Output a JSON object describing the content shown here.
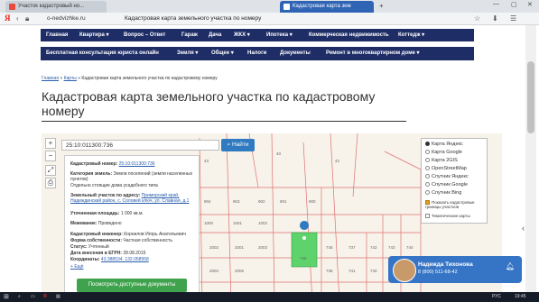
{
  "browser": {
    "tabs": [
      {
        "label": "Участок кадастровый но..."
      },
      {
        "label": "Кадастровая карта зем"
      }
    ],
    "url": "o-nedvizhke.ru",
    "page_title": "Кадастровая карта земельного участка по номеру",
    "yandex_logo": "Я"
  },
  "nav_primary": [
    {
      "label": "Главная"
    },
    {
      "label": "Квартира ▾"
    },
    {
      "label": "Вопрос – Ответ"
    },
    {
      "label": "Гараж"
    },
    {
      "label": "Дача"
    },
    {
      "label": "ЖКХ ▾"
    },
    {
      "label": "Ипотека ▾"
    },
    {
      "label": "Коммерческая недвижимость"
    },
    {
      "label": "Коттедж ▾"
    }
  ],
  "nav_secondary": [
    {
      "label": "Бесплатная консультация юриста онлайн"
    },
    {
      "label": "Земля ▾"
    },
    {
      "label": "Общее ▾"
    },
    {
      "label": "Налоги"
    },
    {
      "label": "Документы"
    },
    {
      "label": "Ремонт в многоквартирном доме ▾"
    }
  ],
  "breadcrumb": {
    "home": "Главная",
    "sep1": "»",
    "maps": "Карты",
    "sep2": "»",
    "current": "Кадастровая карта земельного участка по кадастровому номеру"
  },
  "heading": "Кадастровая карта земельного участка по кадастровому номеру",
  "map": {
    "search_value": "25:10:011300:736",
    "find_button": "Найти",
    "info": {
      "cad_number_label": "Кадастровый номер:",
      "cad_number_value": "25:10:011300:736",
      "category_label": "Категория земель:",
      "category_value": "Земли поселений (земли населенных пунктов)",
      "category_extra": "Отдельно стоящие дома усадебного типа",
      "address_label": "Земельный участок по адресу:",
      "address_value": "Приморский край, Надеждинский район, с. Соловей ключ, ул. Славная, д.1",
      "area_label": "Уточненная площадь:",
      "area_value": "1 000 кв.м.",
      "location_label": "Межевание:",
      "location_value": "Проведено",
      "engineer_label": "Кадастровый инженер:",
      "engineer_value": "Корнилов Игорь Анатольевич",
      "ownership_label": "Форма собственности:",
      "ownership_value": "Частная собственность",
      "status_label": "Статус:",
      "status_value": "Учтенный",
      "date_label": "Дата внесения в ЕГРН:",
      "date_value": "28.08.2015",
      "coords_label": "Координаты:",
      "coords_value": "43.388534, 132.058958",
      "more_link": "Ещё"
    },
    "docs_button": "Посмотреть доступные документы",
    "layers": [
      {
        "label": "Карта Яндекс",
        "selected": true
      },
      {
        "label": "Карта Google",
        "selected": false
      },
      {
        "label": "Карта 2GIS",
        "selected": false
      },
      {
        "label": "OpenStreetMap",
        "selected": false
      },
      {
        "label": "Спутник Яндекс",
        "selected": false
      },
      {
        "label": "Спутник Google",
        "selected": false
      },
      {
        "label": "Спутник Bing",
        "selected": false
      }
    ],
    "overlay_cadastral": "Показать кадастровые границы участков",
    "overlay_thematic": "Тематические карты",
    "parcel_labels": [
      "43",
      "40",
      "42",
      "904",
      "903",
      "902",
      "901",
      "900",
      "1000",
      "1001",
      "1002",
      "736",
      "745",
      "737",
      "742",
      "743",
      "744",
      "738",
      "741",
      "740",
      "739",
      "2002",
      "2001",
      "2003",
      "2004",
      "2005"
    ]
  },
  "contact": {
    "name": "Надежда Тихонова",
    "phone": "8 (800) 511-68-42"
  },
  "taskbar": {
    "lang": "РУС",
    "time": "19:45"
  },
  "colors": {
    "nav": "#1e2d66",
    "accent_tab": "#2f64b5",
    "find_button": "#2f7ac0",
    "docs_button": "#3fa34d",
    "selected_parcel": "#5ed36b"
  }
}
